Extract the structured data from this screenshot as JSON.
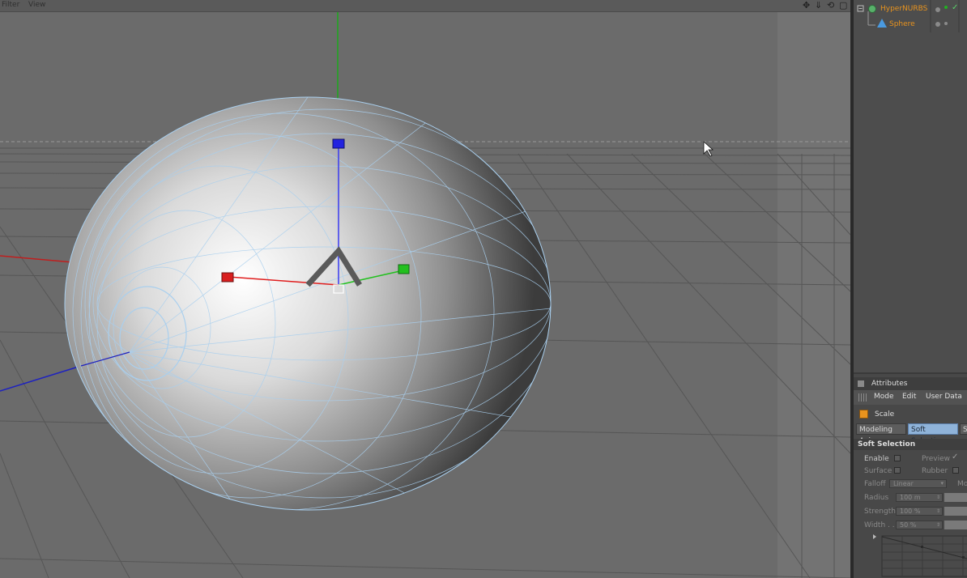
{
  "viewport": {
    "menu": [
      "Filter",
      "View"
    ],
    "nav_icons": [
      {
        "name": "move-view-icon",
        "glyph": "✥"
      },
      {
        "name": "dolly-view-icon",
        "glyph": "⇓"
      },
      {
        "name": "rotate-view-icon",
        "glyph": "⟲"
      },
      {
        "name": "maximize-view-icon",
        "glyph": "▢"
      }
    ]
  },
  "object_manager": {
    "objects": [
      {
        "name": "HyperNURBS"
      },
      {
        "name": "Sphere"
      }
    ],
    "check_glyph": "✓"
  },
  "attributes": {
    "title": "Attributes",
    "menu": [
      "Mode",
      "Edit",
      "User Data"
    ],
    "tool_name": "Scale",
    "tabs": [
      {
        "label": "Modeling Axis",
        "active": false
      },
      {
        "label": "Soft Selection",
        "active": true
      },
      {
        "label": "S",
        "active": false
      }
    ],
    "section_title": "Soft Selection",
    "enable_label": "Enable",
    "preview_label": "Preview",
    "preview_check": "✓",
    "surface_label": "Surface",
    "rubber_label": "Rubber",
    "falloff_label": "Falloff",
    "falloff_value": "Linear",
    "falloff_extra": "Mo",
    "radius_label": "Radius",
    "radius_value": "100 m",
    "strength_label": "Strength",
    "strength_value": "100 %",
    "width_label": "Width . .",
    "width_value": "50 %"
  },
  "colors": {
    "accent_orange": "#e8931e",
    "active_tab": "#8fb3d9",
    "axis_x": "#d81e1e",
    "axis_y": "#22c01e",
    "axis_z": "#1e22d8",
    "wire": "#a9cfee"
  }
}
